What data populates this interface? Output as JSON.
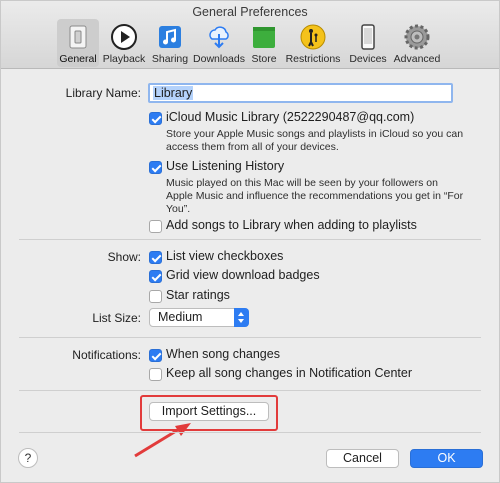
{
  "window": {
    "title": "General Preferences"
  },
  "toolbar": {
    "items": [
      {
        "label": "General",
        "icon": "switch-icon",
        "selected": true
      },
      {
        "label": "Playback",
        "icon": "play-icon"
      },
      {
        "label": "Sharing",
        "icon": "music-note-icon"
      },
      {
        "label": "Downloads",
        "icon": "cloud-download-icon"
      },
      {
        "label": "Store",
        "icon": "store-icon"
      },
      {
        "label": "Restrictions",
        "icon": "parental-icon"
      },
      {
        "label": "Devices",
        "icon": "phone-icon"
      },
      {
        "label": "Advanced",
        "icon": "gear-icon"
      }
    ]
  },
  "library": {
    "label": "Library Name:",
    "value": "Library"
  },
  "icloud": {
    "label": "iCloud Music Library (2522290487@qq.com)",
    "checked": true,
    "desc": "Store your Apple Music songs and playlists in iCloud so you can access them from all of your devices."
  },
  "listening": {
    "label": "Use Listening History",
    "checked": true,
    "desc": "Music played on this Mac will be seen by your followers on Apple Music and influence the recommendations you get in “For You”."
  },
  "add_songs": {
    "label": "Add songs to Library when adding to playlists",
    "checked": false
  },
  "show": {
    "label": "Show:",
    "options": [
      {
        "label": "List view checkboxes",
        "checked": true
      },
      {
        "label": "Grid view download badges",
        "checked": true
      },
      {
        "label": "Star ratings",
        "checked": false
      }
    ]
  },
  "list_size": {
    "label": "List Size:",
    "value": "Medium"
  },
  "notifications": {
    "label": "Notifications:",
    "options": [
      {
        "label": "When song changes",
        "checked": true
      },
      {
        "label": "Keep all song changes in Notification Center",
        "checked": false
      }
    ]
  },
  "buttons": {
    "import": "Import Settings...",
    "cancel": "Cancel",
    "ok": "OK",
    "help": "?"
  },
  "colors": {
    "accent": "#2d7cf2",
    "annotation": "#e23b3b"
  }
}
